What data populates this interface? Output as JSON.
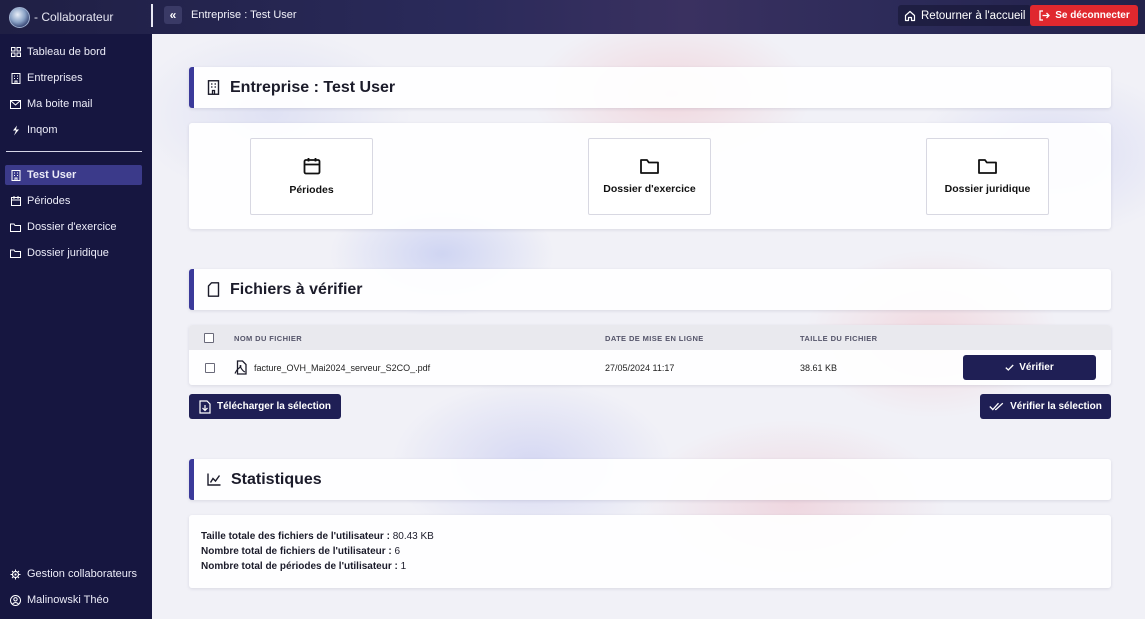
{
  "topbar": {
    "brand_text": "- Collaborateur",
    "breadcrumb": "Entreprise : Test User",
    "home_label": "Retourner à l'accueil",
    "logout_label": "Se déconnecter"
  },
  "sidebar": {
    "nav": [
      {
        "label": "Tableau de bord",
        "icon": "dashboard-icon"
      },
      {
        "label": "Entreprises",
        "icon": "building-icon"
      },
      {
        "label": "Ma boite mail",
        "icon": "mail-icon"
      },
      {
        "label": "Inqom",
        "icon": "inqom-icon"
      }
    ],
    "company": [
      {
        "label": "Test User",
        "icon": "building-icon",
        "active": true
      },
      {
        "label": "Périodes",
        "icon": "calendar-icon"
      },
      {
        "label": "Dossier d'exercice",
        "icon": "folder-icon"
      },
      {
        "label": "Dossier juridique",
        "icon": "folder-icon"
      }
    ],
    "bottom": [
      {
        "label": "Gestion collaborateurs",
        "icon": "gear-icon"
      },
      {
        "label": "Malinowski Théo",
        "icon": "user-circle-icon"
      }
    ]
  },
  "main": {
    "company_title": "Entreprise : Test User",
    "tiles": [
      {
        "label": "Périodes",
        "icon": "calendar-icon"
      },
      {
        "label": "Dossier d'exercice",
        "icon": "folder-icon"
      },
      {
        "label": "Dossier juridique",
        "icon": "folder-icon"
      }
    ],
    "files_title": "Fichiers à vérifier",
    "table": {
      "columns": [
        "NOM DU FICHIER",
        "DATE DE MISE EN LIGNE",
        "TAILLE DU FICHIER"
      ],
      "rows": [
        {
          "name": "facture_OVH_Mai2024_serveur_S2CO_.pdf",
          "date": "27/05/2024 11:17",
          "size": "38.61 KB",
          "action": "Vérifier"
        }
      ]
    },
    "download_selection": "Télécharger la sélection",
    "verify_selection": "Vérifier la sélection",
    "stats_title": "Statistiques",
    "stats": [
      {
        "label": "Taille totale des fichiers de l'utilisateur :",
        "value": "80.43 KB"
      },
      {
        "label": "Nombre total de fichiers de l'utilisateur :",
        "value": "6"
      },
      {
        "label": "Nombre total de périodes de l'utilisateur :",
        "value": "1"
      }
    ]
  },
  "colors": {
    "sidebar_bg": "#161640",
    "accent": "#3b3a9a",
    "primary_button": "#1f1f55",
    "danger": "#e0282e"
  }
}
